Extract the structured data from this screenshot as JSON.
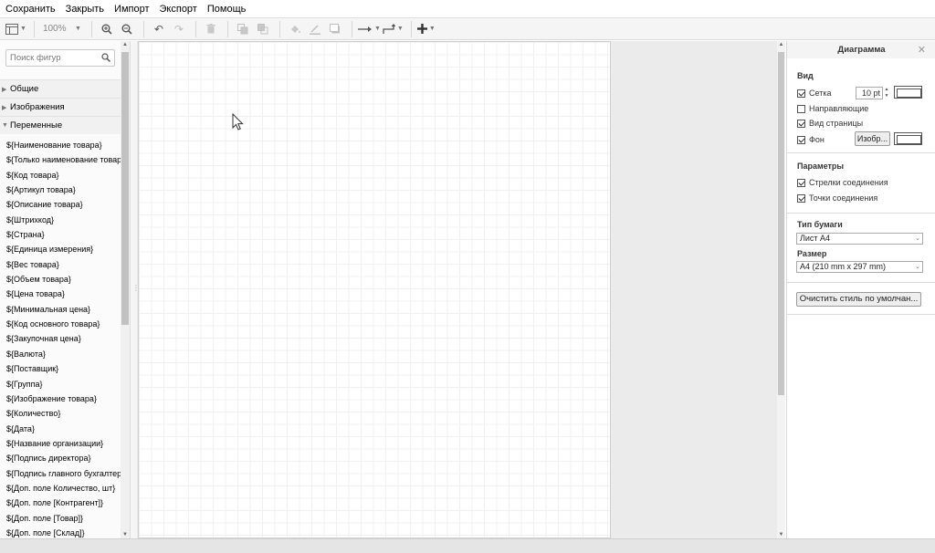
{
  "menu": [
    "Сохранить",
    "Закрыть",
    "Импорт",
    "Экспорт",
    "Помощь"
  ],
  "toolbar": {
    "zoom": "100%",
    "icons": [
      "layout-icon",
      "zoom-in-icon",
      "zoom-out-icon",
      "undo-icon",
      "redo-icon",
      "delete-icon",
      "to-front-icon",
      "to-back-icon",
      "fill-color-icon",
      "line-color-icon",
      "shadow-icon",
      "connection-icon",
      "waypoints-icon",
      "insert-icon"
    ]
  },
  "sidebar": {
    "search_placeholder": "Поиск фигур",
    "sections": [
      "Общие",
      "Изображения",
      "Переменные"
    ],
    "variables": [
      "${Наименование товара}",
      "${Только наименование товара}",
      "${Код товара}",
      "${Артикул товара}",
      "${Описание товара}",
      "${Штрихкод}",
      "${Страна}",
      "${Единица измерения}",
      "${Вес товара}",
      "${Объем товара}",
      "${Цена товара}",
      "${Минимальная цена}",
      "${Код основного товара}",
      "${Закупочная цена}",
      "${Валюта}",
      "${Поставщик}",
      "${Группа}",
      "${Изображение товара}",
      "${Количество}",
      "${Дата}",
      "${Название организации}",
      "${Подпись директора}",
      "${Подпись главного бухгалтера}",
      "${Доп. поле Количество, шт}",
      "${Доп. поле [Контрагент]}",
      "${Доп. поле [Товар]}",
      "${Доп. поле [Склад]}"
    ]
  },
  "panel": {
    "title": "Диаграмма",
    "view_title": "Вид",
    "grid_label": "Сетка",
    "grid_checked": true,
    "grid_size": "10 pt",
    "guides_label": "Направляющие",
    "guides_checked": false,
    "page_view_label": "Вид страницы",
    "page_view_checked": true,
    "background_label": "Фон",
    "background_checked": true,
    "background_image_button": "Изобр...",
    "options_title": "Параметры",
    "connection_arrows_label": "Стрелки соединения",
    "connection_arrows_checked": true,
    "connection_points_label": "Точки соединения",
    "connection_points_checked": true,
    "paper_type_title": "Тип бумаги",
    "paper_type_value": "Лист А4",
    "size_title": "Размер",
    "size_value": "A4 (210 mm x 297 mm)",
    "reset_style_button": "Очистить стиль по умолчан..."
  },
  "colors": {
    "toolbar_bg": "#f5f5f5",
    "canvas_bg": "#ebebeb",
    "grid_line": "#f0f0f0"
  }
}
